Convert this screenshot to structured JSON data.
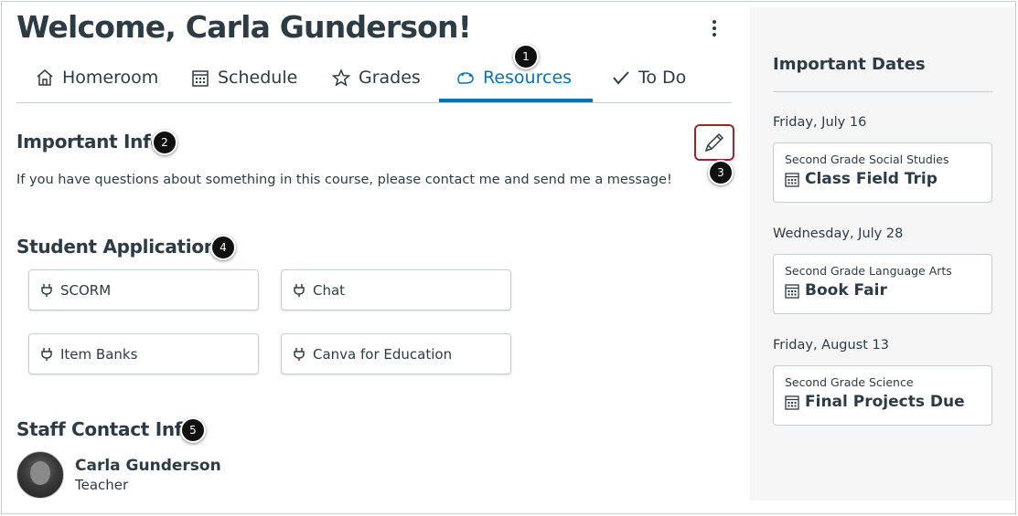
{
  "header": {
    "welcome": "Welcome, Carla Gunderson!"
  },
  "tabs": [
    {
      "label": "Homeroom",
      "icon": "home-icon"
    },
    {
      "label": "Schedule",
      "icon": "calendar-icon"
    },
    {
      "label": "Grades",
      "icon": "star-icon"
    },
    {
      "label": "Resources",
      "icon": "resources-icon",
      "active": true
    },
    {
      "label": "To Do",
      "icon": "check-icon"
    }
  ],
  "badges": [
    "1",
    "2",
    "3",
    "4",
    "5"
  ],
  "important_info": {
    "title": "Important Info",
    "text": "If you have questions about something in this course, please contact me and send me a message!"
  },
  "student_applications": {
    "title": "Student Applications",
    "apps": [
      "SCORM",
      "Chat",
      "Item Banks",
      "Canva for Education"
    ]
  },
  "staff_contact": {
    "title": "Staff Contact Info",
    "name": "Carla Gunderson",
    "role": "Teacher"
  },
  "important_dates": {
    "title": "Important Dates",
    "events": [
      {
        "date": "Friday, July 16",
        "course": "Second Grade Social Studies",
        "title": "Class Field Trip"
      },
      {
        "date": "Wednesday, July 28",
        "course": "Second Grade Language Arts",
        "title": "Book Fair"
      },
      {
        "date": "Friday, August 13",
        "course": "Second Grade Science",
        "title": "Final Projects Due"
      }
    ]
  },
  "colors": {
    "text": "#2d3b45",
    "accent": "#0374b5",
    "edit_highlight": "#a0232b",
    "sidebar_bg": "#f5f5f5"
  }
}
